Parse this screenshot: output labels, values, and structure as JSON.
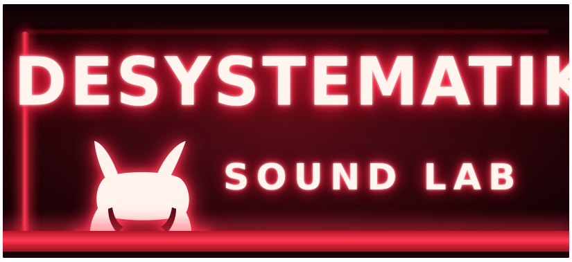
{
  "sign": {
    "title": "DESYSTEMATIK",
    "subtitle": "SOUND LAB",
    "logo_icon": "creature-logo-icon",
    "glow_color": "#ff2a4a",
    "text_color": "#fff4ee"
  }
}
